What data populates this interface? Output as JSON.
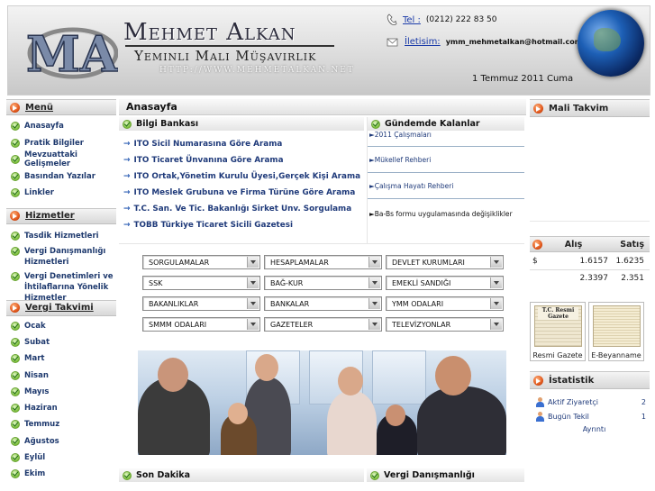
{
  "header": {
    "brand_mark": "MA",
    "brand_name": "Mehmet Alkan",
    "brand_subtitle": "Yeminli Mali Müşavirlik",
    "brand_url": "HTTP://WWW.MEHMETALKAN.NET",
    "phone_label": "Tel :",
    "phone_value": "(0212) 222 83 50",
    "email_label": "İletisim:",
    "email_value": "ymm_mehmetalkan@hotmail.com",
    "date": "1 Temmuz 2011 Cuma"
  },
  "left": {
    "menu": {
      "title": "Menü",
      "items": [
        "Anasayfa",
        "Pratik Bilgiler",
        "Mevzuattaki Gelişmeler",
        "Basından Yazılar",
        "Linkler"
      ]
    },
    "services": {
      "title": "Hizmetler",
      "items": [
        "Tasdik Hizmetleri",
        "Vergi Danışmanlığı Hizmetleri",
        "Vergi Denetimleri ve İhtilaflarına Yönelik Hizmetler"
      ]
    },
    "tax_calendar": {
      "title": "Vergi Takvimi",
      "items": [
        "Ocak",
        "Subat",
        "Mart",
        "Nisan",
        "Mayıs",
        "Haziran",
        "Temmuz",
        "Ağustos",
        "Eylül",
        "Ekim"
      ]
    }
  },
  "main": {
    "title": "Anasayfa",
    "knowledge": {
      "title": "Bilgi Bankası",
      "links": [
        "ITO Sicil Numarasına Göre Arama",
        "ITO Ticaret Ünvanına Göre Arama",
        "ITO Ortak,Yönetim Kurulu Üyesi,Gerçek Kişi Arama",
        "ITO Meslek Grubuna ve Firma Türüne Göre Arama",
        "T.C. San. Ve Tic. Bakanlığı Sirket Unv. Sorgulama",
        "TOBB Türkiye Ticaret Sicili Gazetesi"
      ]
    },
    "agenda": {
      "title": "Gündemde Kalanlar",
      "items": [
        "►2011 Çalışmaları",
        "►Mükellef Rehberi",
        "►Çalışma Hayatı Rehberi",
        "►Ba-Bs formu uygulamasında değişiklikler"
      ]
    },
    "dropdowns": [
      "SORGULAMALAR",
      "HESAPLAMALAR",
      "DEVLET KURUMLARI",
      "SSK",
      "BAĞ-KUR",
      "EMEKLİ SANDIĞI",
      "BAKANLIKLAR",
      "BANKALAR",
      "YMM ODALARI",
      "SMMM ODALARI",
      "GAZETELER",
      "TELEVİZYONLAR"
    ],
    "breaking": {
      "title": "Son Dakika"
    },
    "tax_consulting": {
      "title": "Vergi Danışmanlığı"
    }
  },
  "right": {
    "fiscal_calendar": {
      "title": "Mali Takvim"
    },
    "exchange": {
      "buy_label": "Alış",
      "sell_label": "Satış",
      "rows": [
        {
          "currency": "$",
          "buy": "1.6157",
          "sell": "1.6235"
        },
        {
          "currency": "",
          "buy": "2.3397",
          "sell": "2.351"
        }
      ]
    },
    "thumbnails": [
      {
        "caption": "Resmi Gazete",
        "inner_title": "T.C. Resmi Gazete"
      },
      {
        "caption": "E-Beyanname"
      }
    ],
    "stats": {
      "title": "İstatistik",
      "rows": [
        {
          "label": "Aktif Ziyaretçi",
          "value": "2"
        },
        {
          "label": "Bugün Tekil",
          "value": "1"
        }
      ],
      "details_link": "Ayrıntı"
    }
  },
  "colors": {
    "link_blue": "#1f3a7a",
    "orb_orange": "#e0561b",
    "check_green": "#7cbf3b"
  }
}
